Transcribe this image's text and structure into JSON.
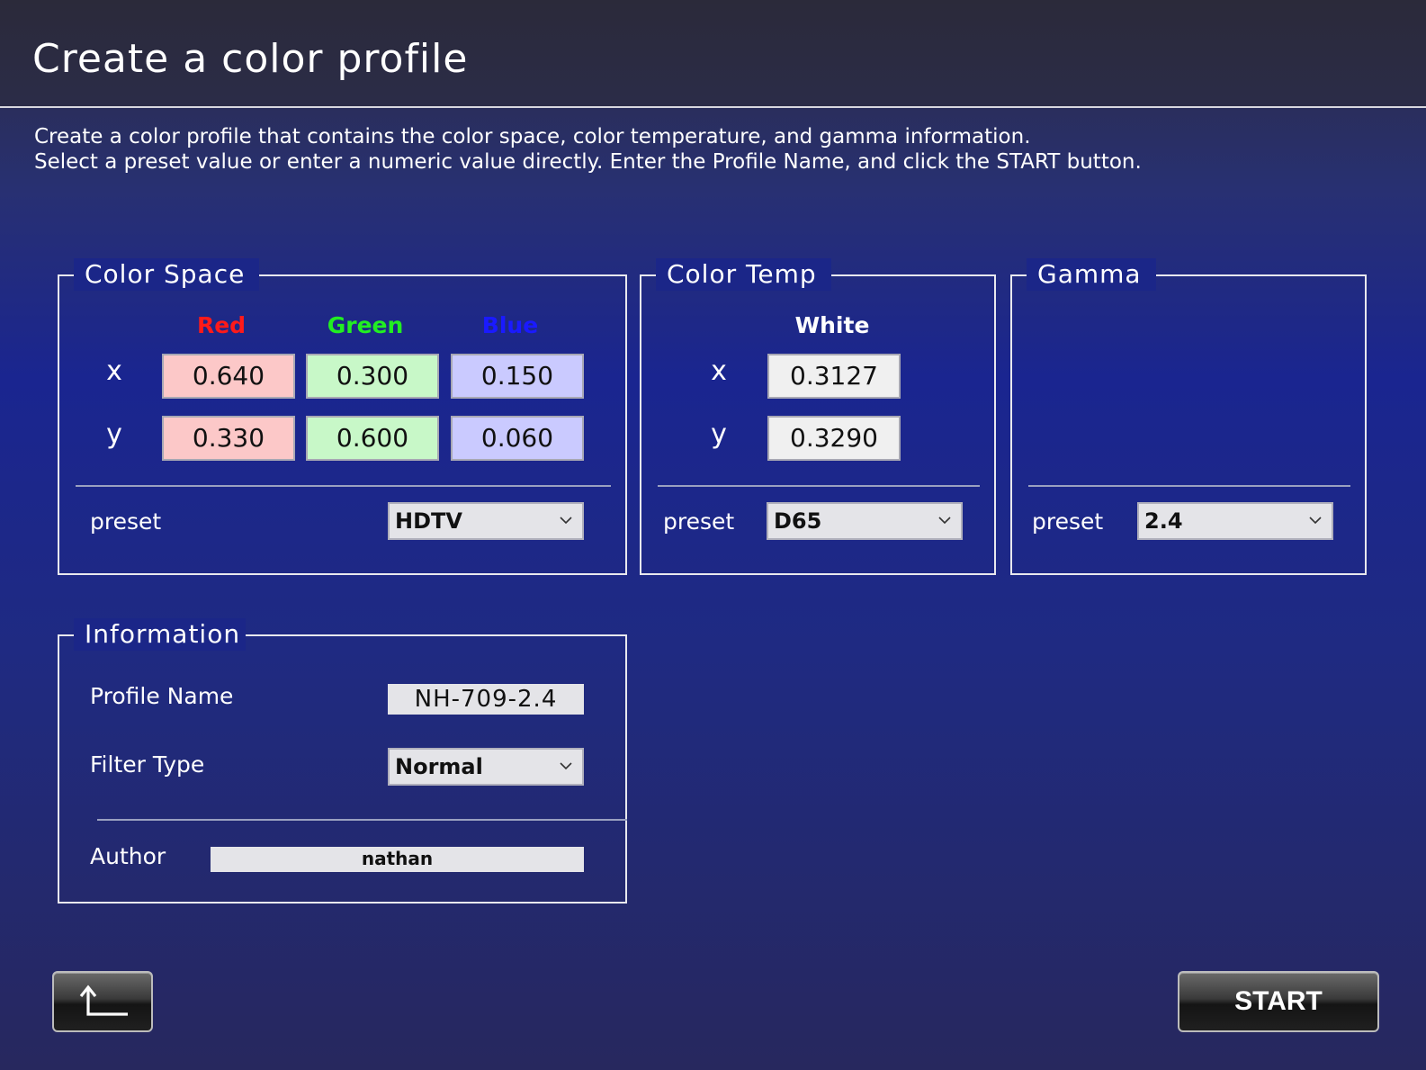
{
  "header": {
    "title": "Create a color profile"
  },
  "description": {
    "line1": "Create a color profile that contains the color space, color temperature, and gamma information.",
    "line2": "Select a preset value or enter a numeric value directly. Enter the Profile Name, and click the START button."
  },
  "color_space": {
    "title": "Color Space",
    "columns": {
      "red": "Red",
      "green": "Green",
      "blue": "Blue"
    },
    "axis_x": "x",
    "axis_y": "y",
    "red": {
      "x": "0.640",
      "y": "0.330"
    },
    "green": {
      "x": "0.300",
      "y": "0.600"
    },
    "blue": {
      "x": "0.150",
      "y": "0.060"
    },
    "preset_label": "preset",
    "preset_value": "HDTV"
  },
  "color_temp": {
    "title": "Color Temp",
    "column": "White",
    "axis_x": "x",
    "axis_y": "y",
    "white": {
      "x": "0.3127",
      "y": "0.3290"
    },
    "preset_label": "preset",
    "preset_value": "D65"
  },
  "gamma": {
    "title": "Gamma",
    "preset_label": "preset",
    "preset_value": "2.4"
  },
  "information": {
    "title": "Information",
    "profile_name_label": "Profile Name",
    "profile_name_value": "NH-709-2.4",
    "filter_type_label": "Filter Type",
    "filter_type_value": "Normal",
    "author_label": "Author",
    "author_value": "nathan"
  },
  "buttons": {
    "start_label": "START"
  },
  "icons": {
    "back": "return-arrow-icon",
    "dropdown": "chevron-down-icon"
  },
  "colors": {
    "red_header": "#ff1a1a",
    "green_header": "#22ee22",
    "blue_header": "#1a1aff",
    "red_field": "#fcc8c8",
    "green_field": "#c8f8c8",
    "blue_field": "#cacaff"
  }
}
